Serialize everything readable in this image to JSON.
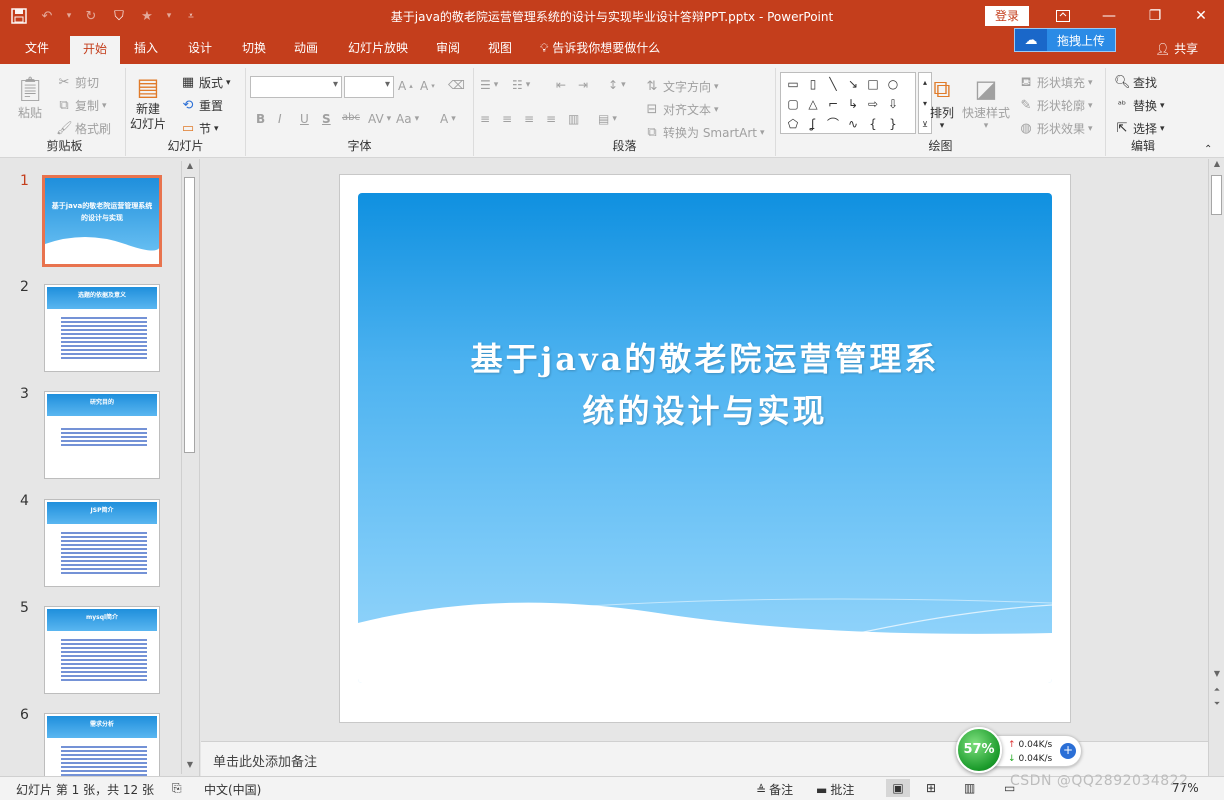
{
  "window": {
    "title": "基于java的敬老院运营管理系统的设计与实现毕业设计答辩PPT.pptx  -  PowerPoint",
    "login_label": "登录",
    "upload_label": "拖拽上传",
    "share_label": "共享"
  },
  "ribbon_tabs": [
    "文件",
    "开始",
    "插入",
    "设计",
    "切换",
    "动画",
    "幻灯片放映",
    "审阅",
    "视图"
  ],
  "active_tab": "开始",
  "tell_me": "告诉我你想要做什么",
  "clipboard": {
    "paste": "粘贴",
    "cut": "剪切",
    "copy": "复制",
    "format_painter": "格式刷",
    "label": "剪贴板"
  },
  "slides_group": {
    "new_slide_1": "新建",
    "new_slide_2": "幻灯片",
    "layout": "版式",
    "reset": "重置",
    "section": "节",
    "label": "幻灯片"
  },
  "font_group": {
    "label": "字体"
  },
  "paragraph_group": {
    "text_direction": "文字方向",
    "align_text": "对齐文本",
    "convert_smartart": "转换为 SmartArt",
    "label": "段落"
  },
  "drawing_group": {
    "arrange": "排列",
    "quick_styles": "快速样式",
    "shape_fill": "形状填充",
    "shape_outline": "形状轮廓",
    "shape_effects": "形状效果",
    "label": "绘图"
  },
  "editing_group": {
    "find": "查找",
    "replace": "替换",
    "select": "选择",
    "label": "编辑"
  },
  "thumbnails": [
    {
      "num": "1",
      "title": "基于java的敬老院运营管理系统的设计与实现"
    },
    {
      "num": "2",
      "title": "选题的依据及意义"
    },
    {
      "num": "3",
      "title": "研究目的"
    },
    {
      "num": "4",
      "title": "JSP简介"
    },
    {
      "num": "5",
      "title": "mysql简介"
    },
    {
      "num": "6",
      "title": "需求分析"
    }
  ],
  "slide": {
    "title_line1": "基于java的敬老院运营管理系",
    "title_line2": "统的设计与实现"
  },
  "notes_placeholder": "单击此处添加备注",
  "status": {
    "slide_info": "幻灯片 第 1 张，共 12 张",
    "language": "中文(中国)",
    "notes": "备注",
    "comments": "批注",
    "zoom": "77%"
  },
  "net_widget": {
    "percent": "57%",
    "up": "0.04K/s",
    "down": "0.04K/s"
  },
  "watermark": "CSDN @QQ2892034822",
  "colors": {
    "accent": "#c43e1c",
    "slide_blue": "#1f8fdc"
  }
}
